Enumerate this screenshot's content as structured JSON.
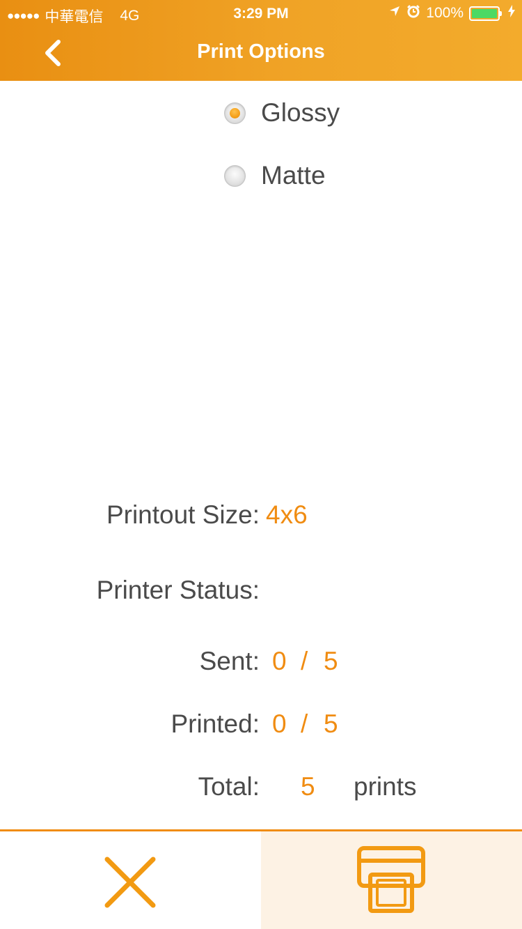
{
  "status_bar": {
    "signal_dots": "●●●●●",
    "carrier": "中華電信",
    "network": "4G",
    "time": "3:29 PM",
    "battery_percent": "100%",
    "location_icon": "location-arrow-icon",
    "alarm_icon": "alarm-clock-icon",
    "charging_icon": "bolt-icon"
  },
  "header": {
    "title": "Print Options",
    "back_icon": "chevron-left-icon"
  },
  "paper_types": [
    {
      "label": "Glossy",
      "selected": true
    },
    {
      "label": "Matte",
      "selected": false
    }
  ],
  "printout_size": {
    "label": "Printout Size:",
    "value": "4x6"
  },
  "printer_status": {
    "label": "Printer Status:"
  },
  "sent": {
    "label": "Sent:",
    "done": "0",
    "separator": "/",
    "total": "5"
  },
  "printed": {
    "label": "Printed:",
    "done": "0",
    "separator": "/",
    "total": "5"
  },
  "total": {
    "label": "Total:",
    "value": "5",
    "unit": "prints"
  },
  "footer": {
    "cancel_icon": "close-icon",
    "print_icon": "printer-icon"
  },
  "colors": {
    "accent": "#f08c12",
    "header_start": "#e98f12",
    "header_end": "#f3ab2c",
    "print_button_bg": "#fdf2e4",
    "text": "#4a4a4a"
  }
}
